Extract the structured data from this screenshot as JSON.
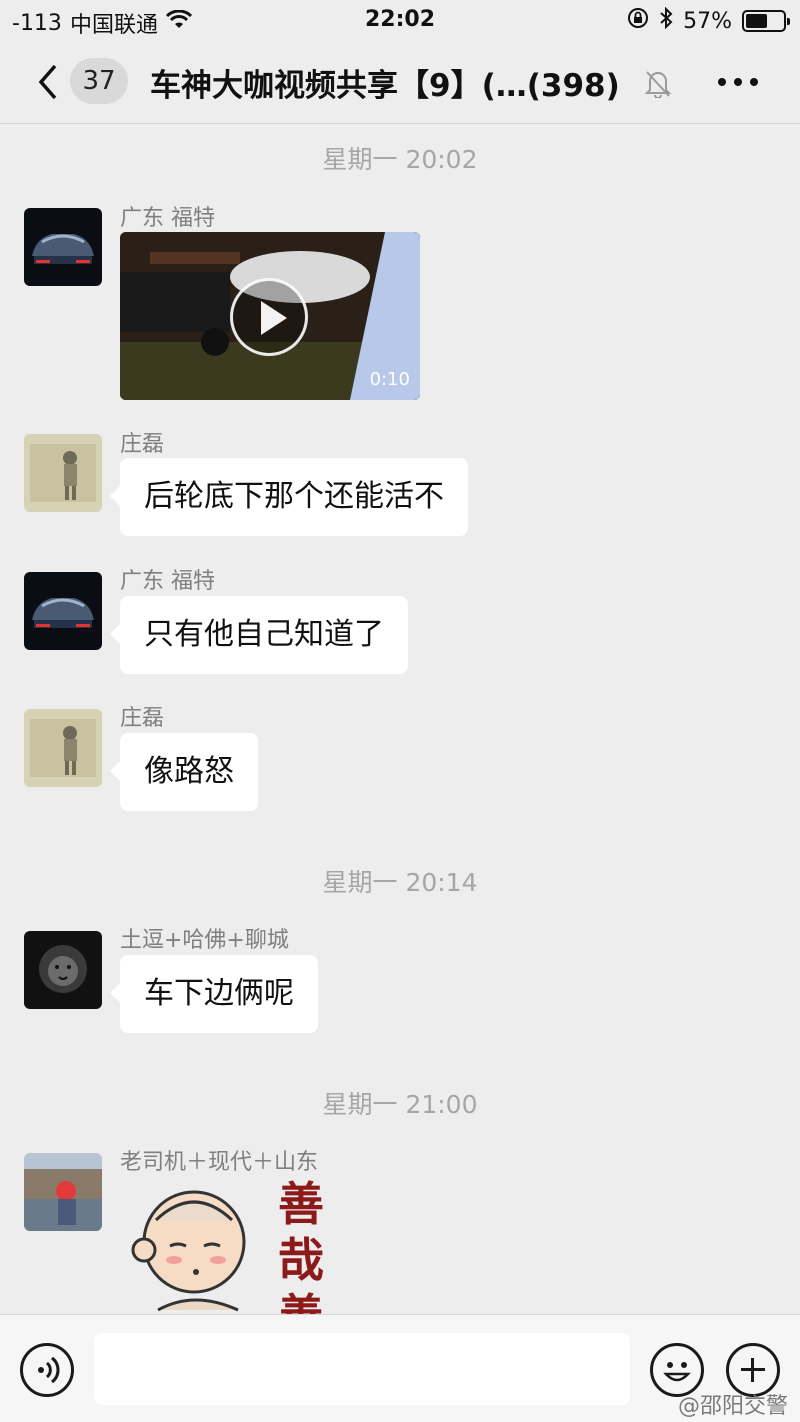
{
  "status_bar": {
    "signal": "-113",
    "carrier": "中国联通",
    "time": "22:02",
    "battery": "57%",
    "battery_level": 0.57
  },
  "nav": {
    "unread_count": "37",
    "title": "车神大咖视频共享【9】(…(398)"
  },
  "messages": [
    {
      "type": "time",
      "text": "星期一 20:02"
    },
    {
      "type": "video",
      "sender": "广东 福特",
      "duration": "0:10"
    },
    {
      "type": "text",
      "sender": "庄磊",
      "text": "后轮底下那个还能活不"
    },
    {
      "type": "text",
      "sender": "广东 福特",
      "text": "只有他自己知道了"
    },
    {
      "type": "text",
      "sender": "庄磊",
      "text": "像路怒"
    },
    {
      "type": "time",
      "text": "星期一 20:14"
    },
    {
      "type": "text",
      "sender": "土逗+哈佛+聊城",
      "text": "车下边俩呢"
    },
    {
      "type": "time",
      "text": "星期一 21:00"
    },
    {
      "type": "sticker",
      "sender": "老司机＋现代＋山东",
      "sticker_text": "善哉善"
    }
  ],
  "input_bar": {
    "placeholder": ""
  },
  "watermark": "@邵阳交警",
  "colors": {
    "background": "#ededed",
    "bubble": "#ffffff",
    "meta_text": "#a6a6a6"
  }
}
